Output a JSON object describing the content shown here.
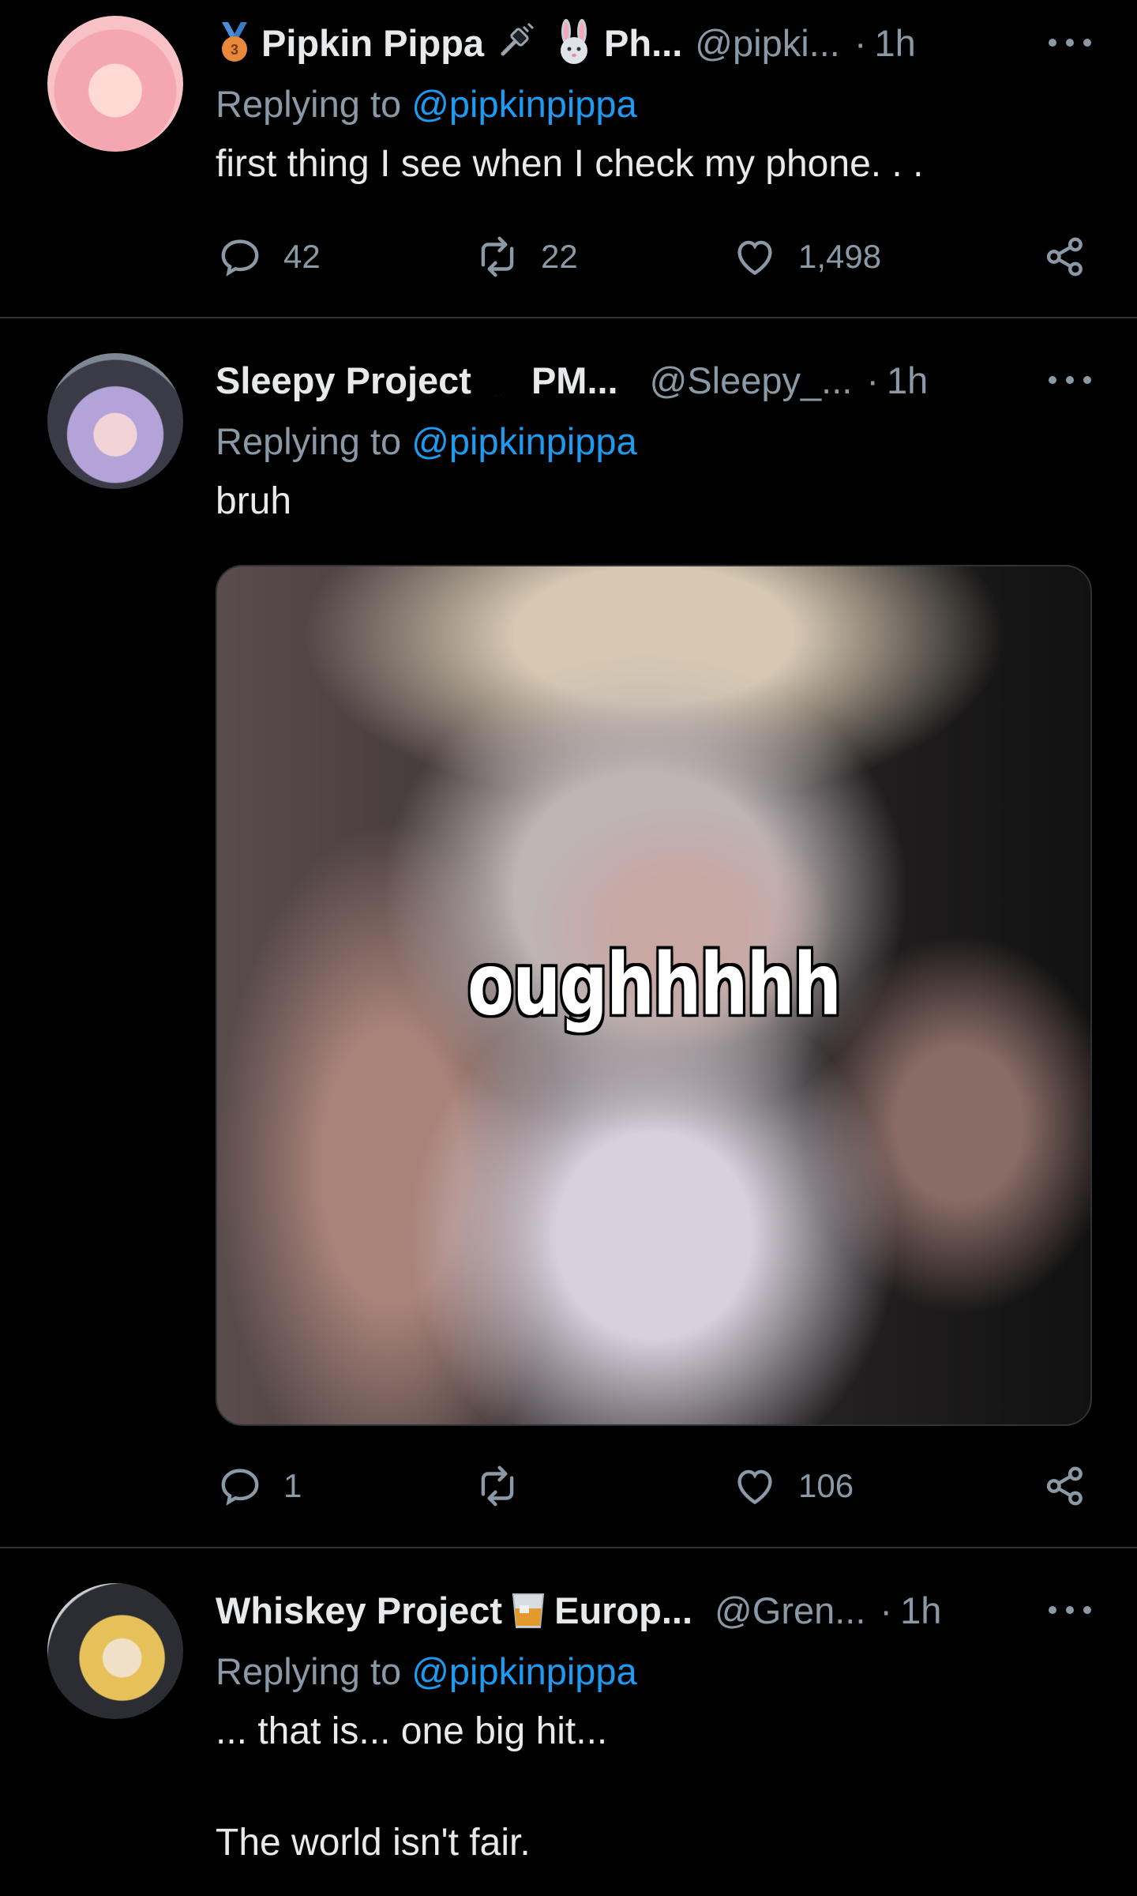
{
  "tweets": [
    {
      "name": "Pipkin Pippa",
      "name_suffix": "Ph...",
      "handle": "@pipki...",
      "time": "1h",
      "replying_prefix": "Replying to",
      "replying_to": "@pipkinpippa",
      "text": "first thing I see when I check my phone. . .",
      "replies": "42",
      "retweets": "22",
      "likes": "1,498"
    },
    {
      "name": "Sleepy Project",
      "name_suffix": "PM...",
      "handle": "@Sleepy_...",
      "time": "1h",
      "replying_prefix": "Replying to",
      "replying_to": "@pipkinpippa",
      "text": "bruh",
      "media_caption": "oughhhhh",
      "replies": "1",
      "retweets": "",
      "likes": "106"
    },
    {
      "name": "Whiskey Project",
      "name_suffix": "Europ...",
      "handle": "@Gren...",
      "time": "1h",
      "replying_prefix": "Replying to",
      "replying_to": "@pipkinpippa",
      "text_line1": "... that is... one big hit...",
      "text_line2": "The world isn't fair."
    }
  ],
  "colors": {
    "background": "#000000",
    "text": "#e7e9ea",
    "muted": "#8b98a5",
    "link": "#1d9bf0",
    "divider": "#2f3336"
  }
}
